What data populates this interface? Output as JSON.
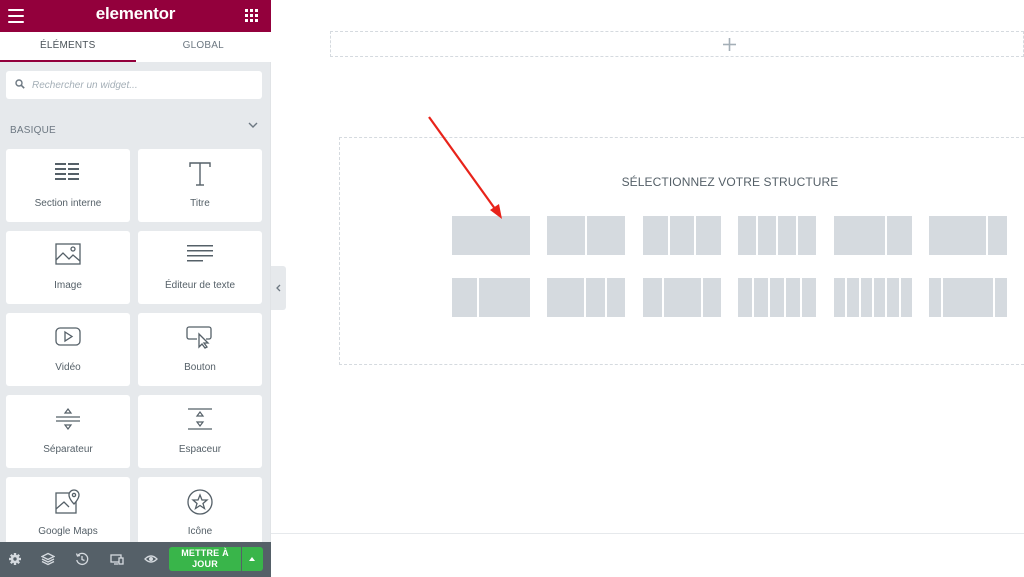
{
  "app": {
    "logo": "elementor"
  },
  "tabs": [
    {
      "label": "ÉLÉMENTS",
      "active": true
    },
    {
      "label": "GLOBAL",
      "active": false
    }
  ],
  "search": {
    "placeholder": "Rechercher un widget...",
    "value": ""
  },
  "category": {
    "label": "BASIQUE",
    "expanded": true
  },
  "widgets": [
    {
      "label": "Section interne",
      "icon": "inner-section-icon"
    },
    {
      "label": "Titre",
      "icon": "heading-icon"
    },
    {
      "label": "Image",
      "icon": "image-icon"
    },
    {
      "label": "Éditeur de texte",
      "icon": "text-editor-icon"
    },
    {
      "label": "Vidéo",
      "icon": "video-icon"
    },
    {
      "label": "Bouton",
      "icon": "button-icon"
    },
    {
      "label": "Séparateur",
      "icon": "divider-icon"
    },
    {
      "label": "Espaceur",
      "icon": "spacer-icon"
    },
    {
      "label": "Google Maps",
      "icon": "google-maps-icon"
    },
    {
      "label": "Icône",
      "icon": "star-icon"
    }
  ],
  "footer": {
    "icons": [
      "settings-icon",
      "navigator-icon",
      "history-icon",
      "responsive-icon",
      "preview-icon"
    ],
    "update_label": "METTRE À JOUR"
  },
  "canvas": {
    "structure_title": "SÉLECTIONNEZ VOTRE STRUCTURE",
    "presets": [
      [
        100
      ],
      [
        50,
        50
      ],
      [
        33,
        33,
        33
      ],
      [
        25,
        25,
        25,
        25
      ],
      [
        66,
        33
      ],
      [
        75,
        25
      ],
      [
        33,
        66
      ],
      [
        66,
        33,
        33
      ],
      [
        33,
        66,
        33
      ],
      [
        20,
        20,
        20,
        20,
        20
      ],
      [
        16,
        16,
        16,
        16,
        16,
        16
      ],
      [
        16,
        66,
        16
      ]
    ]
  },
  "colors": {
    "brand": "#93003c",
    "update": "#39b54a",
    "annotation_arrow": "#e8231a"
  }
}
